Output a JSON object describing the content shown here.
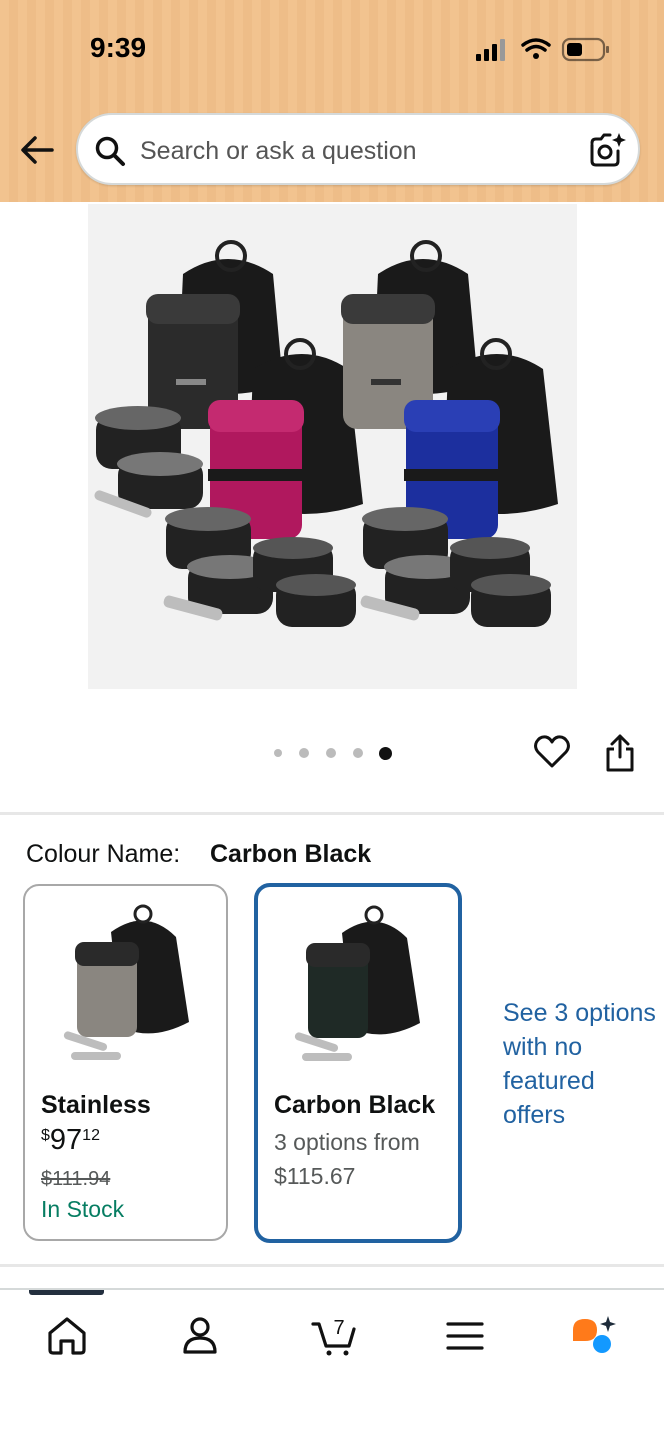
{
  "status_bar": {
    "time": "9:39"
  },
  "search": {
    "placeholder": "Search or ask a question"
  },
  "gallery": {
    "image_count": 5,
    "active_index": 4
  },
  "variation": {
    "label": "Colour Name:",
    "selected": "Carbon Black",
    "swatches": [
      {
        "name": "Stainless",
        "price_symbol": "$",
        "price_whole": "97",
        "price_fraction": "12",
        "list_price": "$111.94",
        "availability": "In Stock"
      },
      {
        "name": "Carbon Black",
        "options_text": "3 options from",
        "options_price": "$115.67"
      }
    ],
    "see_more": [
      "See 3 options",
      "with no",
      "featured",
      "offers"
    ]
  },
  "tabbar": {
    "cart_count": "7",
    "items": [
      "home-icon",
      "account-icon",
      "cart-icon",
      "menu-icon",
      "rufus-assistant-icon"
    ]
  },
  "colors": {
    "header_bg": "#f2c38f",
    "link": "#2162a1",
    "in_stock": "#067d62",
    "selected_border": "#2162a1"
  }
}
